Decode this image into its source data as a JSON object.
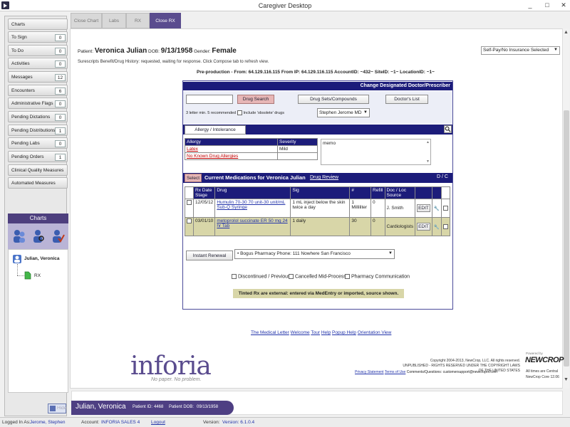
{
  "window": {
    "title": "Caregiver Desktop",
    "minimize": "_",
    "restore": "□",
    "close": "✕"
  },
  "sidebar": {
    "items": [
      {
        "label": "Charts",
        "count": ""
      },
      {
        "label": "To Sign",
        "count": "0"
      },
      {
        "label": "To Do",
        "count": "0"
      },
      {
        "label": "Activities",
        "count": "0"
      },
      {
        "label": "Messages",
        "count": "12"
      },
      {
        "label": "Encounters",
        "count": "6"
      },
      {
        "label": "Administrative Flags",
        "count": "0"
      },
      {
        "label": "Pending Dictations",
        "count": "0"
      },
      {
        "label": "Pending Distributions",
        "count": "1"
      },
      {
        "label": "Pending Labs",
        "count": "0"
      },
      {
        "label": "Pending Orders",
        "count": "1"
      },
      {
        "label": "Clinical Quality Measures",
        "count": ""
      },
      {
        "label": "Automated Measures",
        "count": ""
      }
    ],
    "charts_heading": "Charts",
    "tree_patient": "Julian, Veronica",
    "tree_child": "RX",
    "hide_label": "Hide"
  },
  "tabs": [
    "Close Chart",
    "Labs",
    "RX",
    "Close RX"
  ],
  "patient_header": {
    "patient_label": "Patient:",
    "patient_name": "Veronica Julian",
    "dob_label": "DOB:",
    "dob": "9/13/1958",
    "gender_label": "Gender:",
    "gender": "Female",
    "surescripts_msg": "Surescripts Benefit/Drug History: requested, waiting for response. Click Compose tab to refresh view.",
    "preproduction": "Pre-production - From: 64.129.116.115 From IP: 64.129.116.115 AccountID: ~432~ SiteID: ~1~ LocationID: ~1~",
    "insurance_select": "Self-Pay/No Insurance Selected"
  },
  "rx_panel": {
    "change_doctor": "Change Designated Doctor/Prescriber",
    "drug_search": "Drug Search",
    "drug_sets": "Drug Sets/Compounds",
    "doctors_list": "Doctor's List",
    "min_letters": "3 letter min. 5 recommended",
    "include_obsolete": "Include 'obsolete' drugs",
    "prescriber": "Stephen Jerome MD",
    "allergy_tab": "Allergy / Intolerance",
    "allergy_col": "Allergy",
    "severity_col": "Severity",
    "allergies": [
      {
        "name": "Latex",
        "severity": "Mild"
      },
      {
        "name": "No Known Drug Allergies",
        "severity": ""
      }
    ],
    "memo": "memo",
    "select_btn": "Select",
    "current_meds_title": "Current Medications for Veronica Julian",
    "drug_review": "Drug Review",
    "dc_label": "D / C",
    "med_headers": [
      "Rx Date Stage",
      "Drug",
      "Sig",
      "#",
      "Refill",
      "Doc / Loc Source"
    ],
    "meds": [
      {
        "date": "12/05/12",
        "drug": "Humulin 70-30 70 unit-30 unit/mL Sub-Q Syringe",
        "sig": "1 mL inject below the skin twice a day",
        "qty": "1 Milliliter",
        "refill": "0",
        "source": "J. Smith",
        "edit": "EDIT"
      },
      {
        "date": "03/01/10",
        "drug": "metoprolol succinate ER 50 mg 24 hr Tab",
        "sig": "1 daily",
        "qty": "30",
        "refill": "0",
        "source": "Cardiologists",
        "edit": "EDIT"
      }
    ],
    "instant_renewal": "Instant Renewal",
    "pharmacy": "• Bogus Pharmacy Phone: 111 Nowhere San Francisco",
    "filters": [
      "Discontinued / Previous",
      "Cancelled Mid-Process",
      "Pharmacy Communication"
    ],
    "tinted_note": "Tinted Rx are external: entered via MedEntry or imported, source shown."
  },
  "footer_links": [
    "The Medical Letter",
    "Welcome",
    "Tour",
    "Help",
    "Popup Help",
    "Orientation View"
  ],
  "branding": {
    "logo": "inforia",
    "tagline": "No paper. No problem.",
    "copyright": "Copyright 2004-2013, NewCrop, LLC. All rights reserved.",
    "unpublished": "UNPUBLISHED - RIGHTS RESERVED UNDER THE COPYRIGHT LAWS OF THE UNITED STATES",
    "privacy": "Privacy Statement",
    "terms": "Terms of Use",
    "comments": "Comments/Questions: customersupport@newcroprx.com",
    "newcrop_small": "Powered by",
    "newcrop_logo": "NEWCROP",
    "newcrop_time": "All times are Central",
    "newcrop_version": "NewCrop Core 12.06"
  },
  "patient_bar": {
    "name": "Julian, Veronica",
    "id_label": "Patient ID:",
    "id": "4468",
    "dob_label": "Patient DOB:",
    "dob": "09/13/1958"
  },
  "status": {
    "logged_label": "Logged In As:",
    "user": "Jerome, Stephen",
    "account_label": "Account:",
    "account": "INFORIA SALES 4",
    "logout": "Logout",
    "version_label": "Version:",
    "version": "Version: 6.1.0.4"
  },
  "colors": {
    "accent": "#4e3f83",
    "rx_blue": "#1c1c7a",
    "alert_red": "#c00000",
    "tinted_row": "#d8d6a8"
  }
}
